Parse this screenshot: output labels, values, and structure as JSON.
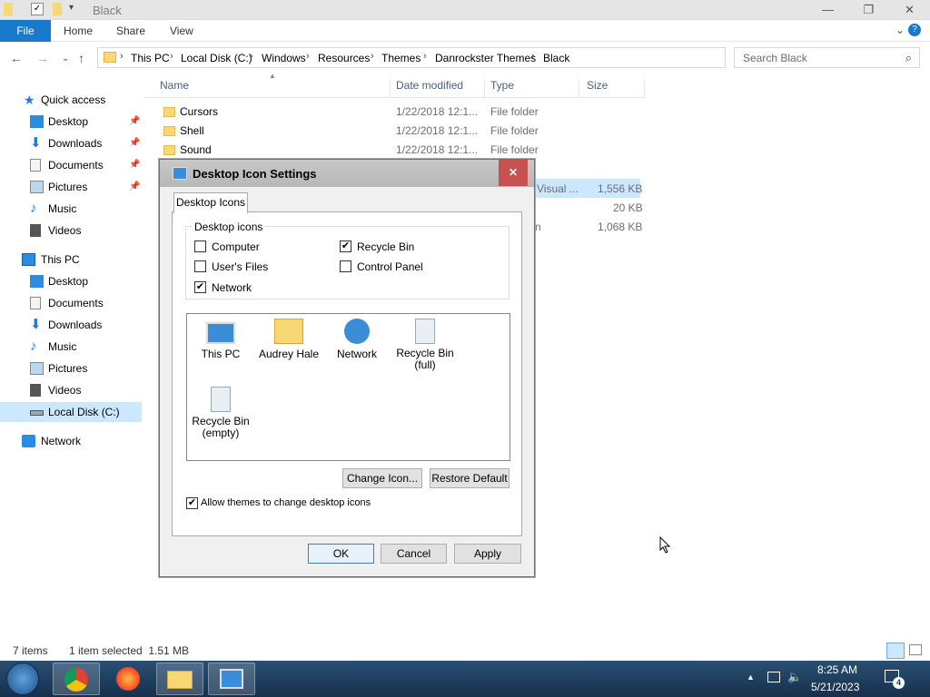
{
  "window": {
    "title": "Black"
  },
  "ribbon": {
    "file": "File",
    "tabs": [
      "Home",
      "Share",
      "View"
    ]
  },
  "address": {
    "crumbs": [
      "This PC",
      "Local Disk (C:)",
      "Windows",
      "Resources",
      "Themes",
      "Danrockster Themes",
      "Black"
    ]
  },
  "search": {
    "placeholder": "Search Black"
  },
  "sidebar": {
    "quick_access": "Quick access",
    "quick_items": [
      "Desktop",
      "Downloads",
      "Documents",
      "Pictures",
      "Music",
      "Videos"
    ],
    "this_pc": "This PC",
    "pc_items": [
      "Desktop",
      "Documents",
      "Downloads",
      "Music",
      "Pictures",
      "Videos",
      "Local Disk (C:)"
    ],
    "network": "Network"
  },
  "columns": {
    "name": "Name",
    "date": "Date modified",
    "type": "Type",
    "size": "Size"
  },
  "files": [
    {
      "name": "Cursors",
      "date": "1/22/2018 12:1...",
      "type": "File folder"
    },
    {
      "name": "Shell",
      "date": "1/22/2018 12:1...",
      "type": "File folder"
    },
    {
      "name": "Sound",
      "date": "1/22/2018 12:1...",
      "type": "File folder"
    }
  ],
  "hidden_rows": {
    "type_fragment": "Visual ...",
    "fragment_n": "n",
    "sizes": [
      "1,556 KB",
      "20 KB",
      "1,068 KB"
    ]
  },
  "status": {
    "items": "7 items",
    "selected": "1 item selected  1.51 MB"
  },
  "taskbar": {
    "time": "8:25 AM",
    "date": "5/21/2023",
    "notif_count": "4"
  },
  "dialog": {
    "title": "Desktop Icon Settings",
    "tab": "Desktop Icons",
    "group_label": "Desktop icons",
    "checkboxes": [
      {
        "label": "Computer",
        "checked": false
      },
      {
        "label": "Recycle Bin",
        "checked": true
      },
      {
        "label": "User's Files",
        "checked": false
      },
      {
        "label": "Control Panel",
        "checked": false
      },
      {
        "label": "Network",
        "checked": true
      }
    ],
    "icons": [
      {
        "label": "This PC",
        "icon": "monitor-icon"
      },
      {
        "label": "Audrey Hale",
        "icon": "user-folder-icon"
      },
      {
        "label": "Network",
        "icon": "network-icon"
      },
      {
        "label": "Recycle Bin\n(full)",
        "icon": "recycle-bin-full-icon"
      },
      {
        "label": "Recycle Bin\n(empty)",
        "icon": "recycle-bin-empty-icon"
      }
    ],
    "change_icon": "Change Icon...",
    "restore_default": "Restore Default",
    "allow_themes": "Allow themes to change desktop icons",
    "allow_themes_checked": true,
    "ok": "OK",
    "cancel": "Cancel",
    "apply": "Apply"
  }
}
